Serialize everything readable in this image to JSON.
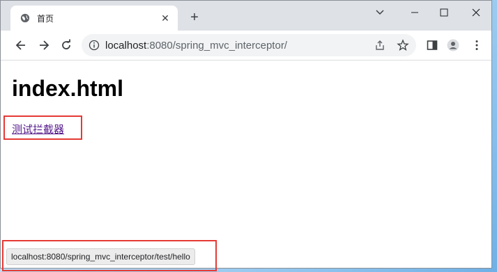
{
  "tab": {
    "title": "首页",
    "close_glyph": "✕",
    "new_tab_glyph": "+"
  },
  "address_bar": {
    "host": "localhost",
    "path": ":8080/spring_mvc_interceptor/"
  },
  "page": {
    "heading": "index.html",
    "link_text": "测试拦截器"
  },
  "status_bar": {
    "url": "localhost:8080/spring_mvc_interceptor/test/hello"
  },
  "colors": {
    "annotation_box": "#e53935",
    "visited_link": "#551a8b",
    "titlebar": "#dee1e6"
  }
}
